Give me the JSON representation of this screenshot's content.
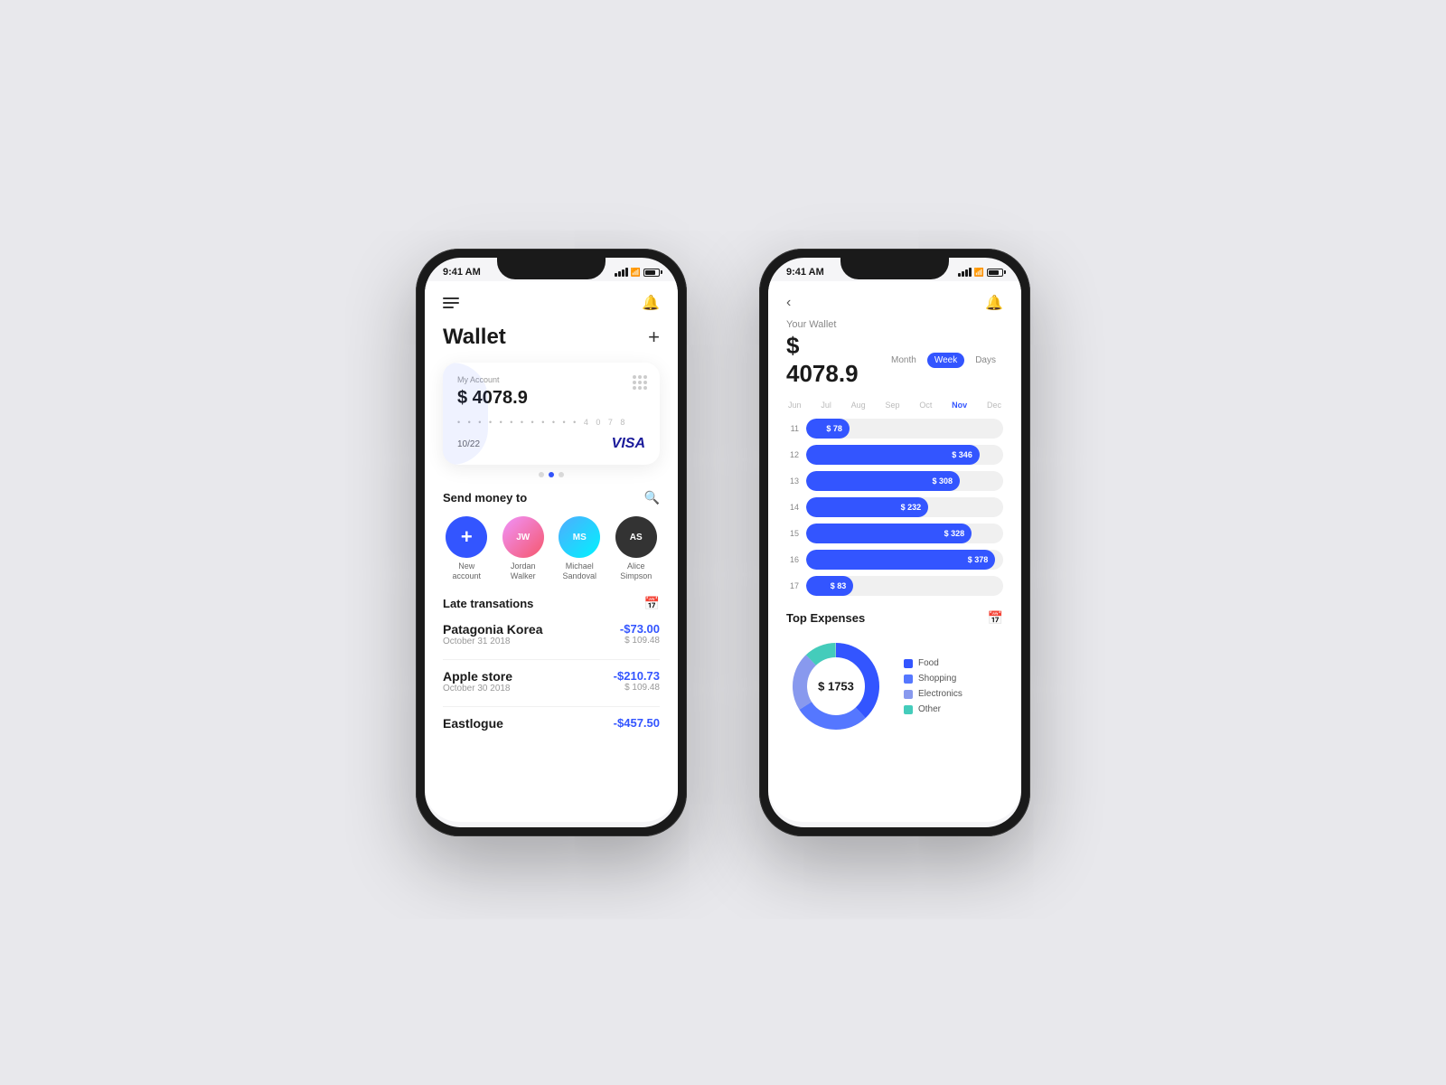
{
  "background": "#e8e8ec",
  "phone1": {
    "status_time": "9:41 AM",
    "header": {
      "title": "Wallet",
      "add_label": "+"
    },
    "card": {
      "label": "My Account",
      "amount": "$ 4078.9",
      "number_masked": "• • • •   • • • •   • • • •   4 0 7 8",
      "expiry": "10/22",
      "brand": "VISA"
    },
    "dots": [
      "",
      "active",
      ""
    ],
    "send_section": {
      "title": "Send money to",
      "contacts": [
        {
          "name": "New\naccount",
          "type": "new"
        },
        {
          "name": "Jordan\nWalker",
          "type": "av1"
        },
        {
          "name": "Michael\nSandoval",
          "type": "av2"
        },
        {
          "name": "Alice\nSimpson",
          "type": "av3"
        }
      ]
    },
    "transactions_section": {
      "title": "Late transations",
      "items": [
        {
          "name": "Patagonia Korea",
          "date": "October 31 2018",
          "amount": "-$73.00",
          "sub": "$ 109.48"
        },
        {
          "name": "Apple store",
          "date": "October 30 2018",
          "amount": "-$210.73",
          "sub": "$ 109.48"
        },
        {
          "name": "Eastlogue",
          "date": "",
          "amount": "-$457.50",
          "sub": ""
        }
      ]
    }
  },
  "phone2": {
    "status_time": "9:41 AM",
    "header": {
      "wallet_label": "Your Wallet",
      "amount": "$ 4078.9",
      "periods": [
        "Month",
        "Week",
        "Days"
      ],
      "active_period": "Week"
    },
    "months": [
      {
        "label": "Jun",
        "active": false
      },
      {
        "label": "Jul",
        "active": false
      },
      {
        "label": "Aug",
        "active": false
      },
      {
        "label": "Sep",
        "active": false
      },
      {
        "label": "Oct",
        "active": false
      },
      {
        "label": "Nov",
        "active": true
      },
      {
        "label": "Dec",
        "active": false
      }
    ],
    "bars": [
      {
        "day": "11",
        "amount": "$ 78",
        "pct": 22
      },
      {
        "day": "12",
        "amount": "$ 346",
        "pct": 88
      },
      {
        "day": "13",
        "amount": "$ 308",
        "pct": 78
      },
      {
        "day": "14",
        "amount": "$ 232",
        "pct": 62
      },
      {
        "day": "15",
        "amount": "$ 328",
        "pct": 84
      },
      {
        "day": "16",
        "amount": "$ 378",
        "pct": 96
      },
      {
        "day": "17",
        "amount": "$ 83",
        "pct": 24
      }
    ],
    "expenses": {
      "title": "Top Expenses",
      "center_label": "$ 1753",
      "legend": [
        {
          "label": "Food",
          "color": "#3355ff"
        },
        {
          "label": "Shopping",
          "color": "#5577ff"
        },
        {
          "label": "Electronics",
          "color": "#7799ff"
        },
        {
          "label": "Other",
          "color": "#44ccbb"
        }
      ],
      "donut": [
        {
          "label": "Food",
          "color": "#3355ff",
          "pct": 38
        },
        {
          "label": "Shopping",
          "color": "#4466ff",
          "pct": 28
        },
        {
          "label": "Electronics",
          "color": "#8899ee",
          "pct": 22
        },
        {
          "label": "Other",
          "color": "#44ccbb",
          "pct": 12
        }
      ]
    }
  }
}
